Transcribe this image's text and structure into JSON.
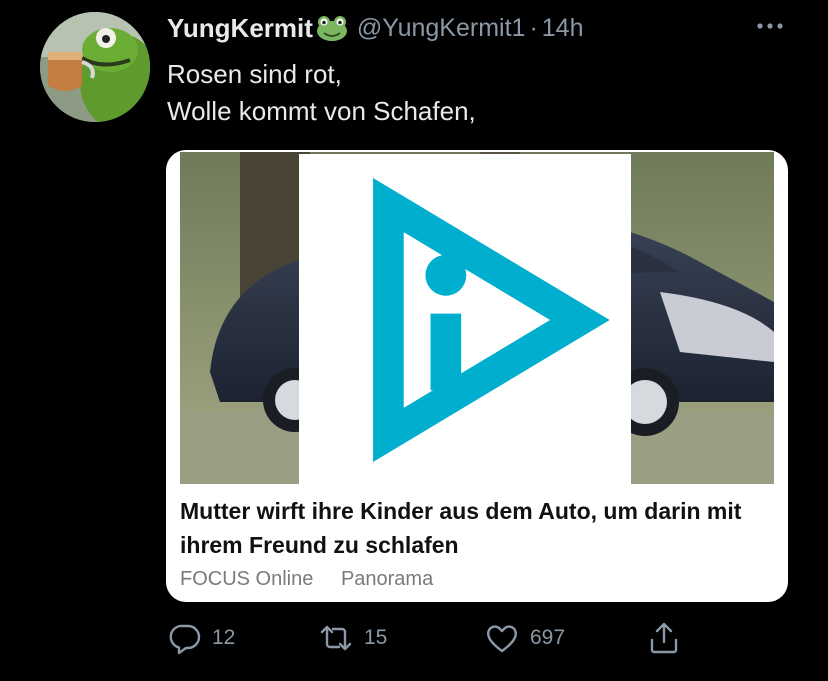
{
  "tweet": {
    "display_name": "YungKermit",
    "name_emoji_icon": "frog-face-icon",
    "handle": "@YungKermit1",
    "separator": "·",
    "time": "14h",
    "text_lines": [
      "Rosen sind rot,",
      "Wolle kommt von Schafen,"
    ]
  },
  "card": {
    "title": "Mutter wirft ihre Kinder aus dem Auto, um darin mit ihrem Freund zu schlafen",
    "source": "FOCUS Online",
    "category": "Panorama",
    "ad_icon": "adchoices-icon"
  },
  "actions": {
    "reply_count": "12",
    "retweet_count": "15",
    "like_count": "697"
  },
  "colors": {
    "background": "#000000",
    "primary_text": "#e7e9ea",
    "secondary_text": "#8b98a5",
    "card_background": "#ffffff",
    "adchoices_blue": "#00aecd"
  }
}
